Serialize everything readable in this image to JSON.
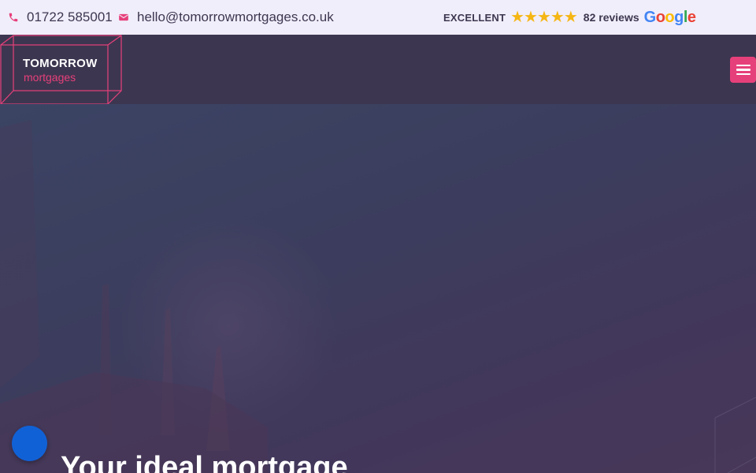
{
  "topbar": {
    "phone": {
      "icon": "phone-icon",
      "text": "01722 585001"
    },
    "email": {
      "icon": "envelope-icon",
      "text": "hello@tomorrowmortgages.co.uk"
    },
    "reviews": {
      "rating_label": "EXCELLENT",
      "stars": 5,
      "count_label": "82 reviews",
      "provider": "Google"
    }
  },
  "header": {
    "logo": {
      "line1": "TOMORROW",
      "line2": "mortgages"
    },
    "menu_icon": "hamburger-menu-icon"
  },
  "hero": {
    "title": "Your ideal mortgage"
  },
  "chat": {
    "icon": "chat-bubble-icon"
  },
  "colors": {
    "accent": "#e6407a",
    "topbar_bg": "#f1eefb",
    "header_bg": "#3d3650",
    "star": "#f5b614",
    "chat": "#1161d6"
  }
}
